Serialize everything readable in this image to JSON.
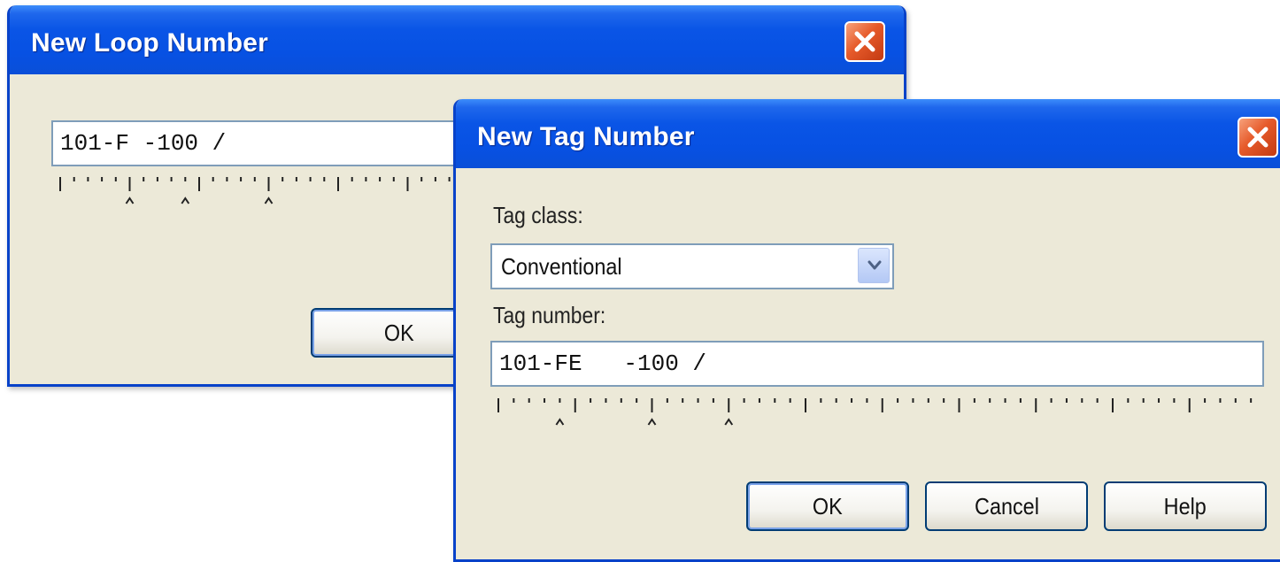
{
  "loop_dialog": {
    "title": "New Loop Number",
    "close_icon": "close-icon",
    "input_value": "101-F -100 /",
    "ruler_markers": 3,
    "ok_label": "OK"
  },
  "tag_dialog": {
    "title": "New Tag Number",
    "close_icon": "close-icon",
    "tag_class_label": "Tag class:",
    "tag_class_value": "Conventional",
    "dropdown_icon": "chevron-down-icon",
    "tag_number_label": "Tag number:",
    "tag_number_value": "101-FE   -100 /",
    "ruler_markers": 3,
    "ok_label": "OK",
    "cancel_label": "Cancel",
    "help_label": "Help"
  },
  "colors": {
    "titlebar": "#0a55e6",
    "dialog_bg": "#ece9d8",
    "close_button": "#e65a2a",
    "input_border": "#7f9db9"
  }
}
